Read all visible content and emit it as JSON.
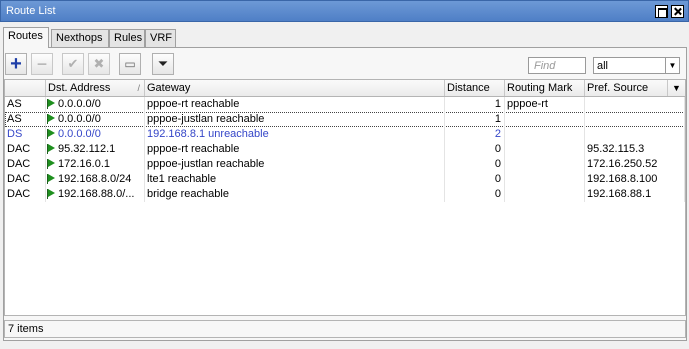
{
  "window": {
    "title": "Route List"
  },
  "tabs": [
    {
      "label": "Routes"
    },
    {
      "label": "Nexthops"
    },
    {
      "label": "Rules"
    },
    {
      "label": "VRF"
    }
  ],
  "toolbar": {
    "find_placeholder": "Find",
    "filter_value": "all",
    "icons": [
      "plus-icon",
      "minus-icon",
      "check-icon",
      "cross-icon",
      "comment-icon",
      "filter-icon"
    ]
  },
  "table": {
    "columns": [
      "",
      "Dst. Address",
      "Gateway",
      "Distance",
      "Routing Mark",
      "Pref. Source"
    ],
    "rows": [
      {
        "flags": "AS",
        "dst": "0.0.0.0/0",
        "gateway": "pppoe-rt reachable",
        "distance": "1",
        "mark": "pppoe-rt",
        "pref": ""
      },
      {
        "flags": "AS",
        "dst": "0.0.0.0/0",
        "gateway": "pppoe-justlan reachable",
        "distance": "1",
        "mark": "",
        "pref": ""
      },
      {
        "flags": "DS",
        "dst": "0.0.0.0/0",
        "gateway": "192.168.8.1 unreachable",
        "distance": "2",
        "mark": "",
        "pref": ""
      },
      {
        "flags": "DAC",
        "dst": "95.32.112.1",
        "gateway": "pppoe-rt reachable",
        "distance": "0",
        "mark": "",
        "pref": "95.32.115.3"
      },
      {
        "flags": "DAC",
        "dst": "172.16.0.1",
        "gateway": "pppoe-justlan reachable",
        "distance": "0",
        "mark": "",
        "pref": "172.16.250.52"
      },
      {
        "flags": "DAC",
        "dst": "192.168.8.0/24",
        "gateway": "lte1 reachable",
        "distance": "0",
        "mark": "",
        "pref": "192.168.8.100"
      },
      {
        "flags": "DAC",
        "dst": "192.168.88.0/...",
        "gateway": "bridge reachable",
        "distance": "0",
        "mark": "",
        "pref": "192.168.88.1"
      }
    ]
  },
  "status": {
    "text": "7 items"
  }
}
